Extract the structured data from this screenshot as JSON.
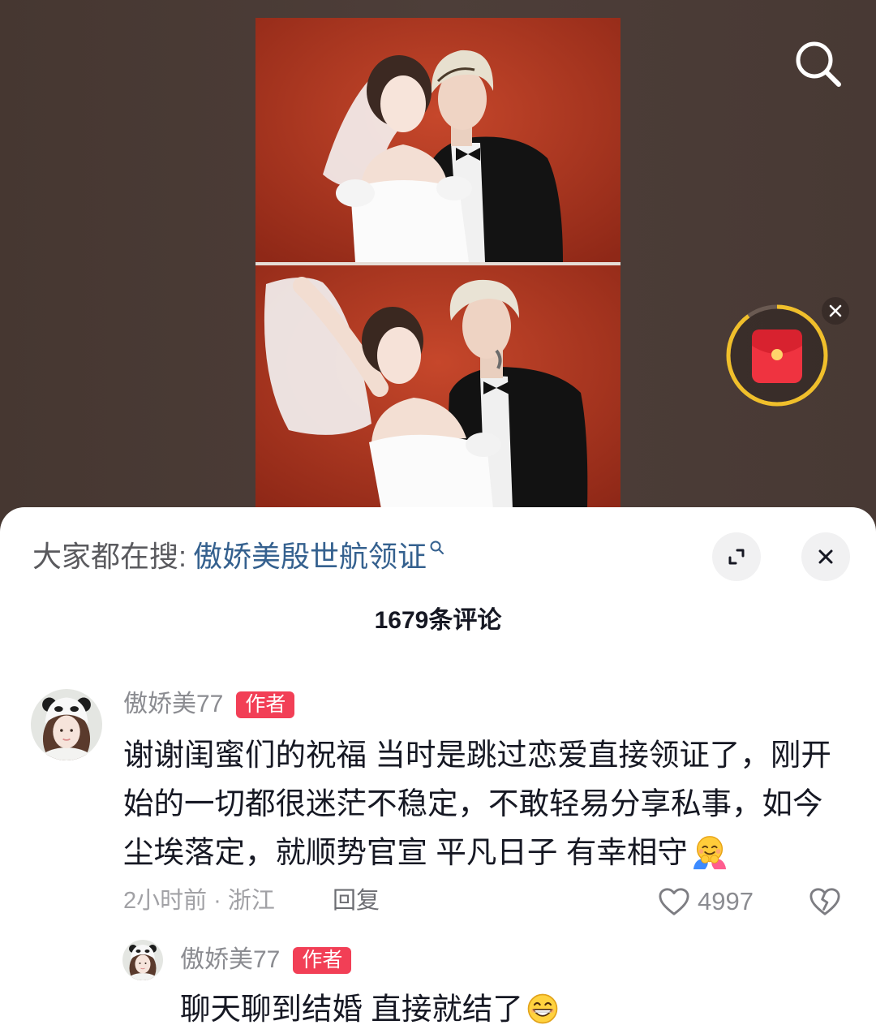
{
  "top_controls": {
    "search_icon": "search-icon"
  },
  "red_packet": {
    "icon": "red-envelope-icon",
    "close_icon": "close-icon",
    "progress": 0.9
  },
  "comment_panel": {
    "search_hint": {
      "prefix": "大家都在搜:",
      "query": "傲娇美殷世航领证",
      "icon": "search-icon"
    },
    "expand_icon": "expand-icon",
    "close_icon": "close-icon",
    "title": "1679条评论",
    "comments": [
      {
        "avatar": "user-avatar",
        "username": "傲娇美77",
        "badge": "作者",
        "text_lines": [
          "谢谢闺蜜们的祝福 当时是跳过恋爱直接领证了，刚开",
          "始的一切都很迷茫不稳定，不敢轻易分享私事，如今",
          "尘埃落定，就顺势官宣 平凡日子 有幸相守"
        ],
        "trailing_emoji": "hug-emoji-icon",
        "time_location": "2小时前 · 浙江",
        "reply_label": "回复",
        "like_icon": "heart-icon",
        "likes": "4997",
        "dislike_icon": "broken-heart-icon",
        "replies": [
          {
            "avatar": "user-avatar",
            "username": "傲娇美77",
            "badge": "作者",
            "text": "聊天聊到结婚 直接就结了",
            "trailing_emoji": "grin-emoji-icon"
          }
        ]
      }
    ]
  },
  "colors": {
    "backdrop": "#4a3b36",
    "author_badge": "#f23f56",
    "search_query": "#35618f",
    "packet_ring": "#f0bf2b",
    "packet_red": "#ef3340"
  }
}
